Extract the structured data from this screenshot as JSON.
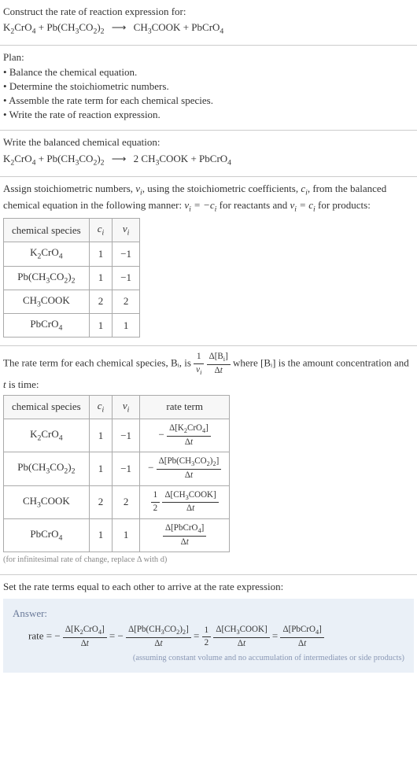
{
  "section1": {
    "prompt": "Construct the rate of reaction expression for:",
    "equation": "K₂CrO₄ + Pb(CH₃CO₂)₂ ⟶ CH₃COOK + PbCrO₄"
  },
  "plan": {
    "heading": "Plan:",
    "items": [
      "Balance the chemical equation.",
      "Determine the stoichiometric numbers.",
      "Assemble the rate term for each chemical species.",
      "Write the rate of reaction expression."
    ]
  },
  "balanced": {
    "heading": "Write the balanced chemical equation:",
    "equation": "K₂CrO₄ + Pb(CH₃CO₂)₂ ⟶ 2 CH₃COOK + PbCrO₄"
  },
  "stoich_assign": {
    "text_pre": "Assign stoichiometric numbers, ",
    "nu_i": "νᵢ",
    "text_mid1": ", using the stoichiometric coefficients, ",
    "c_i": "cᵢ",
    "text_mid2": ", from the balanced chemical equation in the following manner: ",
    "rule_reactants": "νᵢ = −cᵢ",
    "text_mid3": " for reactants and ",
    "rule_products": "νᵢ = cᵢ",
    "text_mid4": " for products:",
    "table": {
      "headers": [
        "chemical species",
        "cᵢ",
        "νᵢ"
      ],
      "rows": [
        [
          "K₂CrO₄",
          "1",
          "−1"
        ],
        [
          "Pb(CH₃CO₂)₂",
          "1",
          "−1"
        ],
        [
          "CH₃COOK",
          "2",
          "2"
        ],
        [
          "PbCrO₄",
          "1",
          "1"
        ]
      ]
    }
  },
  "rate_term": {
    "text_pre": "The rate term for each chemical species, Bᵢ, is ",
    "frac1_num": "1",
    "frac1_den": "νᵢ",
    "frac2_num": "Δ[Bᵢ]",
    "frac2_den": "Δt",
    "text_mid": " where [Bᵢ] is the amount concentration and ",
    "t_var": "t",
    "text_post": " is time:",
    "table": {
      "headers": [
        "chemical species",
        "cᵢ",
        "νᵢ",
        "rate term"
      ],
      "rows": [
        {
          "species": "K₂CrO₄",
          "c": "1",
          "nu": "−1",
          "term_prefix": "−",
          "term_coef_num": "",
          "term_coef_den": "",
          "num": "Δ[K₂CrO₄]",
          "den": "Δt"
        },
        {
          "species": "Pb(CH₃CO₂)₂",
          "c": "1",
          "nu": "−1",
          "term_prefix": "−",
          "term_coef_num": "",
          "term_coef_den": "",
          "num": "Δ[Pb(CH₃CO₂)₂]",
          "den": "Δt"
        },
        {
          "species": "CH₃COOK",
          "c": "2",
          "nu": "2",
          "term_prefix": "",
          "term_coef_num": "1",
          "term_coef_den": "2",
          "num": "Δ[CH₃COOK]",
          "den": "Δt"
        },
        {
          "species": "PbCrO₄",
          "c": "1",
          "nu": "1",
          "term_prefix": "",
          "term_coef_num": "",
          "term_coef_den": "",
          "num": "Δ[PbCrO₄]",
          "den": "Δt"
        }
      ]
    },
    "note": "(for infinitesimal rate of change, replace Δ with d)"
  },
  "final": {
    "heading": "Set the rate terms equal to each other to arrive at the rate expression:",
    "answer_label": "Answer:",
    "rate_label": "rate = ",
    "terms": [
      {
        "prefix": "−",
        "coef_num": "",
        "coef_den": "",
        "num": "Δ[K₂CrO₄]",
        "den": "Δt"
      },
      {
        "prefix": "−",
        "coef_num": "",
        "coef_den": "",
        "num": "Δ[Pb(CH₃CO₂)₂]",
        "den": "Δt"
      },
      {
        "prefix": "",
        "coef_num": "1",
        "coef_den": "2",
        "num": "Δ[CH₃COOK]",
        "den": "Δt"
      },
      {
        "prefix": "",
        "coef_num": "",
        "coef_den": "",
        "num": "Δ[PbCrO₄]",
        "den": "Δt"
      }
    ],
    "note": "(assuming constant volume and no accumulation of intermediates or side products)"
  },
  "chem": {
    "K2CrO4": "K₂CrO₄",
    "PbAc2": "Pb(CH₃CO₂)₂",
    "CH3COOK": "CH₃COOK",
    "PbCrO4": "PbCrO₄",
    "arrow": "⟶",
    "two": "2"
  }
}
